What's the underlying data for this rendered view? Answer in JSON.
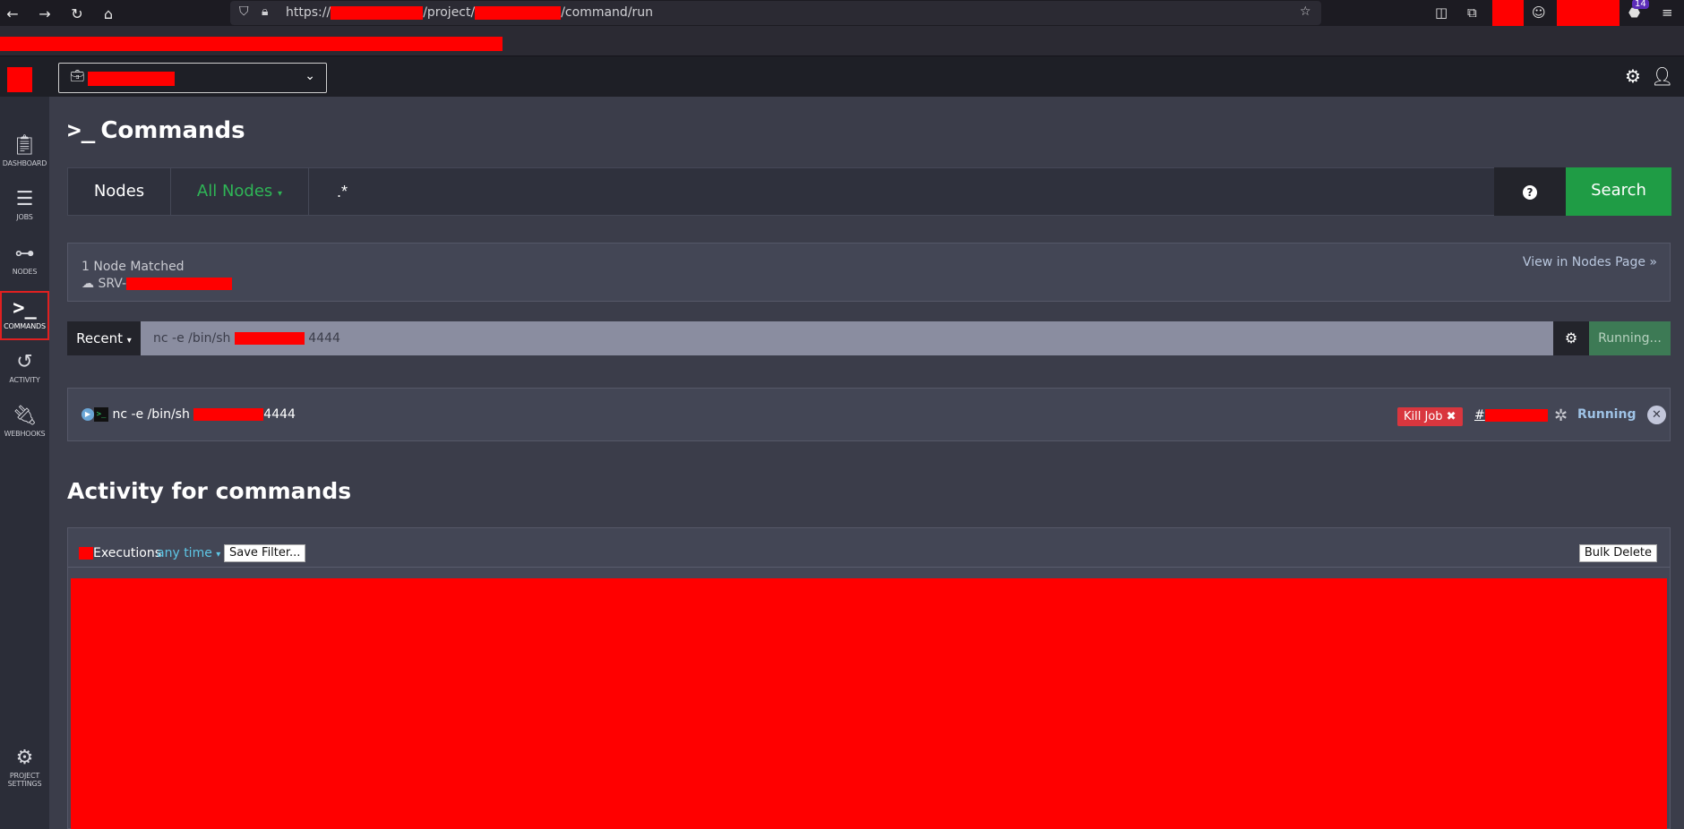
{
  "browser": {
    "url_prefix": "https://",
    "url_mid": "/project/",
    "url_suffix": "/command/run",
    "badge_count": "14"
  },
  "sidebar": {
    "items": [
      {
        "label": "DASHBOARD",
        "icon": "clipboard-icon"
      },
      {
        "label": "JOBS",
        "icon": "list-icon"
      },
      {
        "label": "NODES",
        "icon": "sitemap-icon"
      },
      {
        "label": "COMMANDS",
        "icon": "terminal-icon"
      },
      {
        "label": "ACTIVITY",
        "icon": "history-icon"
      },
      {
        "label": "WEBHOOKS",
        "icon": "plug-icon"
      },
      {
        "label": "PROJECT SETTINGS",
        "icon": "gears-icon"
      }
    ]
  },
  "page": {
    "title": "Commands"
  },
  "nodefilter": {
    "nodes_label": "Nodes",
    "all_nodes_label": "All Nodes",
    "filter_value": ".*",
    "help_label": "?",
    "search_label": "Search"
  },
  "matched": {
    "count_text": "1 Node Matched",
    "node_prefix": "SRV-",
    "view_link": "View in Nodes Page »"
  },
  "command": {
    "recent_label": "Recent",
    "input_prefix": "nc -e /bin/sh",
    "input_port": "4444",
    "running_label": "Running..."
  },
  "execution": {
    "cmd_prefix": "nc -e /bin/sh",
    "cmd_port": "4444",
    "kill_label": "Kill Job ✖",
    "id_prefix": "#",
    "status_label": "Running"
  },
  "activity": {
    "title": "Activity for commands",
    "executions_label": "Executions",
    "time_filter": "any time",
    "save_filter_label": "Save Filter...",
    "bulk_delete_label": "Bulk Delete"
  },
  "colors": {
    "accent_green": "#1f9c45",
    "danger_red": "#d9363e",
    "link_blue": "#5ec7e6"
  }
}
